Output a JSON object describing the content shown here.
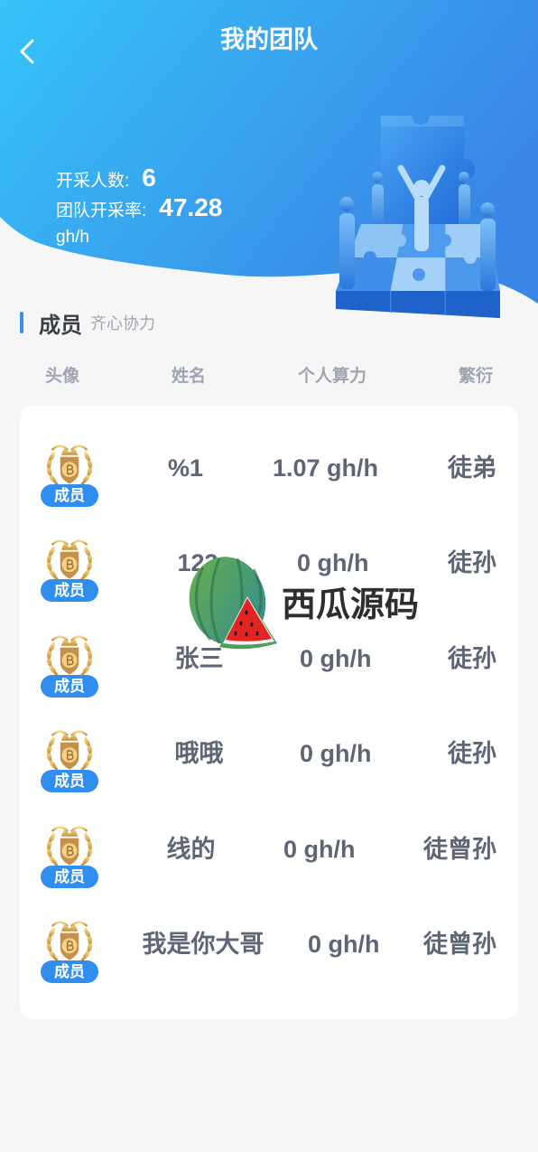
{
  "header": {
    "title": "我的团队",
    "back_icon": "chevron-left-icon"
  },
  "stats": {
    "miners_label": "开采人数:",
    "miners_value": "6",
    "rate_label": "团队开采率:",
    "rate_value": "47.28",
    "rate_unit": "gh/h"
  },
  "illustration_icon": "team-puzzle-illustration",
  "section": {
    "title": "成员",
    "subtitle": "齐心协力"
  },
  "columns": {
    "avatar": "头像",
    "name": "姓名",
    "hashrate": "个人算力",
    "relation": "繁衍"
  },
  "members": [
    {
      "avatar_icon": "bitcoin-badge-icon",
      "badge": "成员",
      "name": "%1",
      "hashrate": "1.07 gh/h",
      "relation": "徒弟"
    },
    {
      "avatar_icon": "bitcoin-badge-icon",
      "badge": "成员",
      "name": "123",
      "hashrate": "0 gh/h",
      "relation": "徒孙"
    },
    {
      "avatar_icon": "bitcoin-badge-icon",
      "badge": "成员",
      "name": "张三",
      "hashrate": "0 gh/h",
      "relation": "徒孙"
    },
    {
      "avatar_icon": "bitcoin-badge-icon",
      "badge": "成员",
      "name": "哦哦",
      "hashrate": "0 gh/h",
      "relation": "徒孙"
    },
    {
      "avatar_icon": "bitcoin-badge-icon",
      "badge": "成员",
      "name": "线的",
      "hashrate": "0 gh/h",
      "relation": "徒曾孙"
    },
    {
      "avatar_icon": "bitcoin-badge-icon",
      "badge": "成员",
      "name": "我是你大哥",
      "hashrate": "0 gh/h",
      "relation": "徒曾孙"
    }
  ],
  "watermark": {
    "text": "西瓜源码",
    "logo_icon": "watermelon-icon"
  },
  "colors": {
    "header_gradient_start": "#36c4f8",
    "header_gradient_end": "#3a86e6",
    "accent": "#3a8ef0",
    "badge": "#2f8ef0",
    "row_text": "#5e6676",
    "column_header_text": "#9ea5b0",
    "page_background": "#f6f6f6",
    "card_background": "#ffffff"
  }
}
